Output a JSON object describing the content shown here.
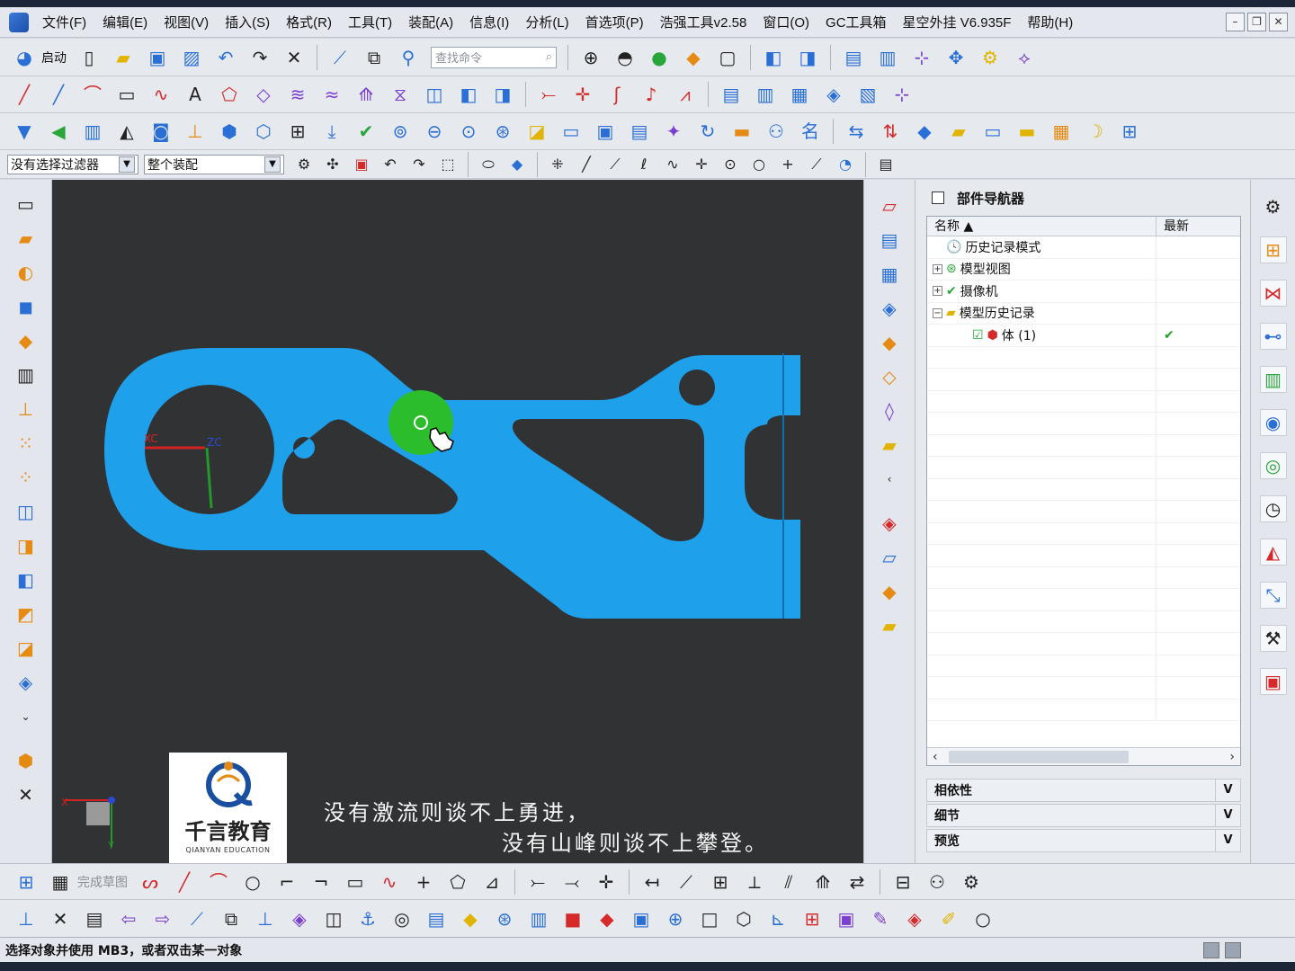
{
  "menu": {
    "items": [
      "文件(F)",
      "编辑(E)",
      "视图(V)",
      "插入(S)",
      "格式(R)",
      "工具(T)",
      "装配(A)",
      "信息(I)",
      "分析(L)",
      "首选项(P)",
      "浩强工具v2.58",
      "窗口(O)",
      "GC工具箱",
      "星空外挂 V6.935F",
      "帮助(H)"
    ]
  },
  "toolbar": {
    "start_label": "启动",
    "search_placeholder": "查找命令"
  },
  "selection": {
    "filter_value": "没有选择过滤器",
    "scope_value": "整个装配"
  },
  "navigator": {
    "title": "部件导航器",
    "col_name": "名称",
    "col_latest": "最新",
    "rows": [
      {
        "label": "历史记录模式",
        "expander": "",
        "icon": "clock-icon"
      },
      {
        "label": "模型视图",
        "expander": "+",
        "icon": "model-view-icon"
      },
      {
        "label": "摄像机",
        "expander": "+",
        "icon": "camera-icon"
      },
      {
        "label": "模型历史记录",
        "expander": "−",
        "icon": "folder-icon"
      },
      {
        "label": "体 (1)",
        "expander": "",
        "icon": "body-icon",
        "latest": "✔"
      }
    ],
    "panels": [
      "相依性",
      "细节",
      "预览"
    ]
  },
  "bottom_toolbar": {
    "finish_sketch_label": "完成草图"
  },
  "status": {
    "message": "选择对象并使用 MB3，或者双击某一对象"
  },
  "viewport": {
    "axis_x": "XC",
    "axis_z": "ZC",
    "triad_x": "X",
    "triad_y": "Y",
    "colors": {
      "background": "#303234",
      "part": "#1fa0ea",
      "highlight": "#2bbd2b"
    }
  },
  "logo": {
    "name": "千言教育",
    "english": "QIANYAN EDUCATION"
  },
  "subtitle": {
    "line1": "没有激流则谈不上勇进，",
    "line2": "没有山峰则谈不上攀登。"
  }
}
